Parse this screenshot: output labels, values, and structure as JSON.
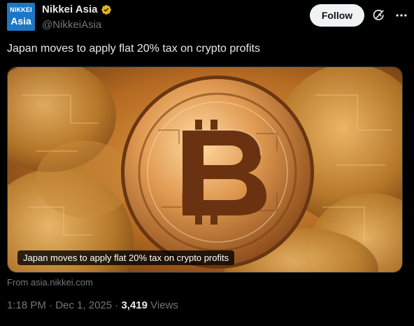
{
  "account": {
    "avatar_line1": "NIKKEI",
    "avatar_line2": "Asia",
    "display_name": "Nikkei Asia",
    "handle": "@NikkeiAsia",
    "verified_color": "#e2b719"
  },
  "actions": {
    "follow_label": "Follow",
    "grok_icon": "grok-icon",
    "more_icon": "more-icon"
  },
  "tweet": {
    "text": "Japan moves to apply flat 20% tax on crypto profits"
  },
  "card": {
    "title": "Japan moves to apply flat 20% tax on crypto profits",
    "source": "From asia.nikkei.com",
    "image": "bitcoin-coins"
  },
  "meta": {
    "time": "1:18 PM",
    "date": "Dec 1, 2025",
    "views_count": "3,419",
    "views_label": "Views",
    "separator": "·"
  },
  "colors": {
    "background": "#000000",
    "text_primary": "#e7e9ea",
    "text_secondary": "#71767b",
    "brand": "#1d77c4"
  }
}
